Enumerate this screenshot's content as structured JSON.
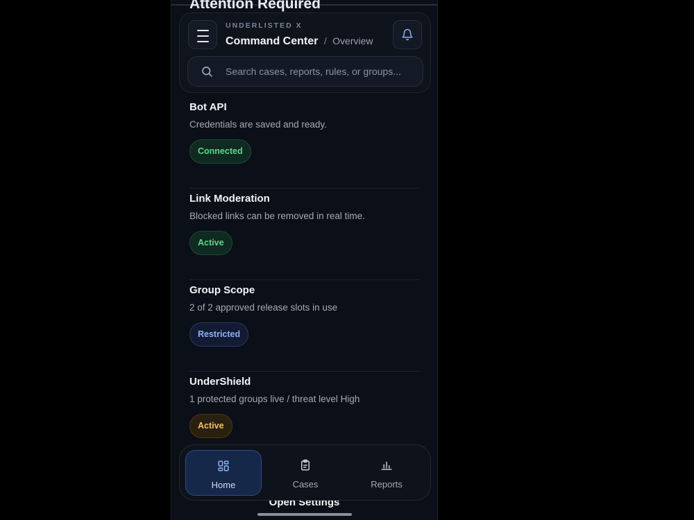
{
  "behind_title": "Attention Required",
  "header": {
    "brand": "UNDERLISTED X",
    "title": "Command Center",
    "separator": "/",
    "subtitle": "Overview",
    "menu_icon": "menu-icon",
    "bell_icon": "bell-icon"
  },
  "search": {
    "placeholder": "Search cases, reports, rules, or groups...",
    "icon": "search-icon"
  },
  "items": [
    {
      "name": "Bot API",
      "desc": "Credentials are saved and ready.",
      "badge": "Connected",
      "badge_color": "#5fd68c"
    },
    {
      "name": "Link Moderation",
      "desc": "Blocked links can be removed in real time.",
      "badge": "Active",
      "badge_color": "#5fd68c"
    },
    {
      "name": "Group Scope",
      "desc": "2 of 2 approved release slots in use",
      "badge": "Restricted",
      "badge_color": "#8fb1f3"
    },
    {
      "name": "UnderShield",
      "desc": "1 protected groups live / threat level High",
      "badge": "Active",
      "badge_color": "#f1c162"
    }
  ],
  "open_settings": "Open Settings",
  "tabs": [
    {
      "label": "Home",
      "icon": "grid-icon",
      "active": true
    },
    {
      "label": "Cases",
      "icon": "clipboard-icon",
      "active": false
    },
    {
      "label": "Reports",
      "icon": "bar-chart-icon",
      "active": false
    }
  ],
  "colors": {
    "background": "#0b0f17",
    "accent": "#2d4c8a",
    "success": "#5fd68c",
    "warning": "#f1c162"
  }
}
